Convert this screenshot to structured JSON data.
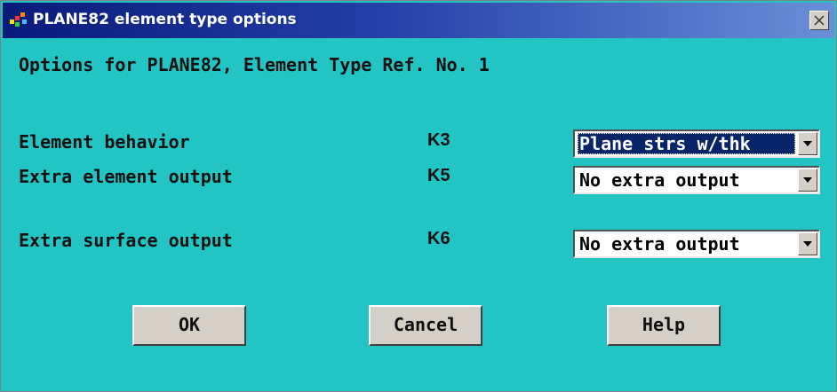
{
  "window": {
    "title": "PLANE82 element type options",
    "heading": "Options for PLANE82, Element Type Ref. No. 1"
  },
  "options": [
    {
      "label": "Element behavior",
      "key": "K3",
      "value": "Plane strs w/thk"
    },
    {
      "label": "Extra element output",
      "key": "K5",
      "value": "No extra output"
    },
    {
      "label": "Extra surface output",
      "key": "K6",
      "value": "No extra output"
    }
  ],
  "buttons": {
    "ok": "OK",
    "cancel": "Cancel",
    "help": "Help"
  },
  "colors": {
    "background": "#22c4c4",
    "titlebar": "#0a1a7a",
    "selection": "#0a246a"
  },
  "icons": {
    "app": "ansys-app-icon",
    "close": "close-icon",
    "dropdown": "chevron-down-icon"
  }
}
